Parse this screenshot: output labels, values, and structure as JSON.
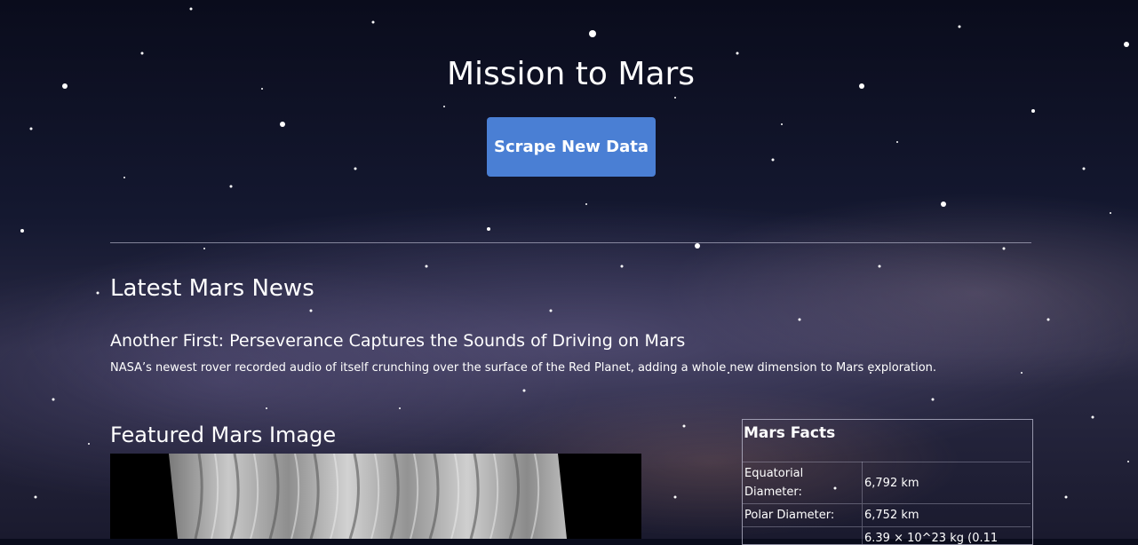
{
  "header": {
    "title": "Mission to Mars",
    "scrape_button_label": "Scrape New Data",
    "accent_color": "#4a7fd4"
  },
  "news": {
    "heading": "Latest Mars News",
    "title": "Another First: Perseverance Captures the Sounds of Driving on Mars",
    "teaser": "NASA’s newest rover recorded audio of itself crunching over the surface of the Red Planet, adding a whole new dimension to Mars exploration."
  },
  "featured": {
    "heading": "Featured Mars Image"
  },
  "facts": {
    "heading": "Mars Facts",
    "rows": [
      {
        "label": "Equatorial Diameter:",
        "value": "6,792 km"
      },
      {
        "label": "Polar Diameter:",
        "value": "6,752 km"
      },
      {
        "label": "",
        "value": "6.39 × 10^23 kg (0.11"
      }
    ]
  }
}
